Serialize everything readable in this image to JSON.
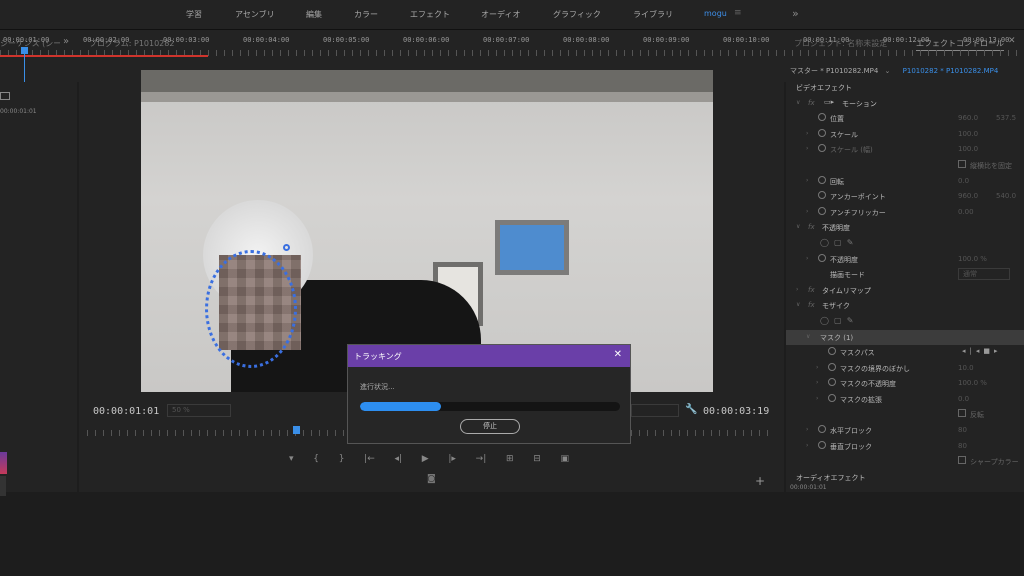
{
  "workspace_tabs": [
    "学習",
    "アセンブリ",
    "編集",
    "カラー",
    "エフェクト",
    "オーディオ",
    "グラフィック",
    "ライブラリ",
    "mogu"
  ],
  "workspace_active": "mogu",
  "workspace_menu_icon": "hamburger-icon",
  "left_panel": {
    "title": "シーケンス (シータイトル)",
    "time": "00:00:01:01"
  },
  "program": {
    "title": "プログラム: P1010282",
    "timecode_left": "00:00:01:01",
    "fit_value": "50 %",
    "timecode_right": "00:00:03:19"
  },
  "effects": {
    "tab_project": "プロジェクト: 名称未設定",
    "tab_effect_controls": "エフェクトコントロール",
    "master_clip": "マスター * P1010282.MP4",
    "sequence_clip": "P1010282 * P1010282.MP4",
    "rows": [
      {
        "label": "ビデオエフェクト",
        "v1": "",
        "v2": ""
      },
      {
        "label": "モーション",
        "v1": "",
        "v2": ""
      },
      {
        "label": "位置",
        "v1": "960.0",
        "v2": "537.5"
      },
      {
        "label": "スケール",
        "v1": "100.0",
        "v2": ""
      },
      {
        "label": "スケール (幅)",
        "v1": "100.0",
        "v2": ""
      },
      {
        "label": "縦横比を固定",
        "v1": "",
        "v2": ""
      },
      {
        "label": "回転",
        "v1": "0.0",
        "v2": ""
      },
      {
        "label": "アンカーポイント",
        "v1": "960.0",
        "v2": "540.0"
      },
      {
        "label": "アンチフリッカー",
        "v1": "0.00",
        "v2": ""
      },
      {
        "label": "不透明度",
        "v1": "",
        "v2": ""
      },
      {
        "label": "",
        "v1": "",
        "v2": ""
      },
      {
        "label": "不透明度",
        "v1": "100.0 %",
        "v2": ""
      },
      {
        "label": "描画モード",
        "v1": "通常",
        "v2": ""
      },
      {
        "label": "タイムリマップ",
        "v1": "",
        "v2": ""
      },
      {
        "label": "モザイク",
        "v1": "",
        "v2": ""
      },
      {
        "label": "",
        "v1": "",
        "v2": ""
      },
      {
        "label": "マスク (1)",
        "v1": "",
        "v2": ""
      },
      {
        "label": "マスクパス",
        "v1": "",
        "v2": ""
      },
      {
        "label": "マスクの境界のぼかし",
        "v1": "10.0",
        "v2": ""
      },
      {
        "label": "マスクの不透明度",
        "v1": "100.0 %",
        "v2": ""
      },
      {
        "label": "マスクの拡張",
        "v1": "0.0",
        "v2": ""
      },
      {
        "label": "反転",
        "v1": "",
        "v2": ""
      },
      {
        "label": "水平ブロック",
        "v1": "80",
        "v2": ""
      },
      {
        "label": "垂直ブロック",
        "v1": "80",
        "v2": ""
      },
      {
        "label": "シャープカラー",
        "v1": "",
        "v2": ""
      },
      {
        "label": "オーディオエフェクト",
        "v1": "",
        "v2": ""
      }
    ],
    "bottom_time": "00:00:01:01"
  },
  "dialog": {
    "title": "トラッキング",
    "status": "進行状況...",
    "progress": 0.31,
    "stop_label": "停止"
  },
  "timeline": {
    "times": [
      "00:00:01:00",
      "00:00:02:00",
      "00:00:03:00",
      "00:00:04:00",
      "00:00:05:00",
      "00:00:06:00",
      "00:00:07:00",
      "00:00:08:00",
      "00:00:09:00",
      "00:00:10:00",
      "00:00:11:00",
      "00:00:12:00",
      "00:00:13:00"
    ]
  },
  "colors": {
    "accent_blue": "#3a8fe8",
    "dialog_purple": "#6a3fa8",
    "progress_blue": "#2d8ef0",
    "render_bar_red": "#d0342c"
  }
}
